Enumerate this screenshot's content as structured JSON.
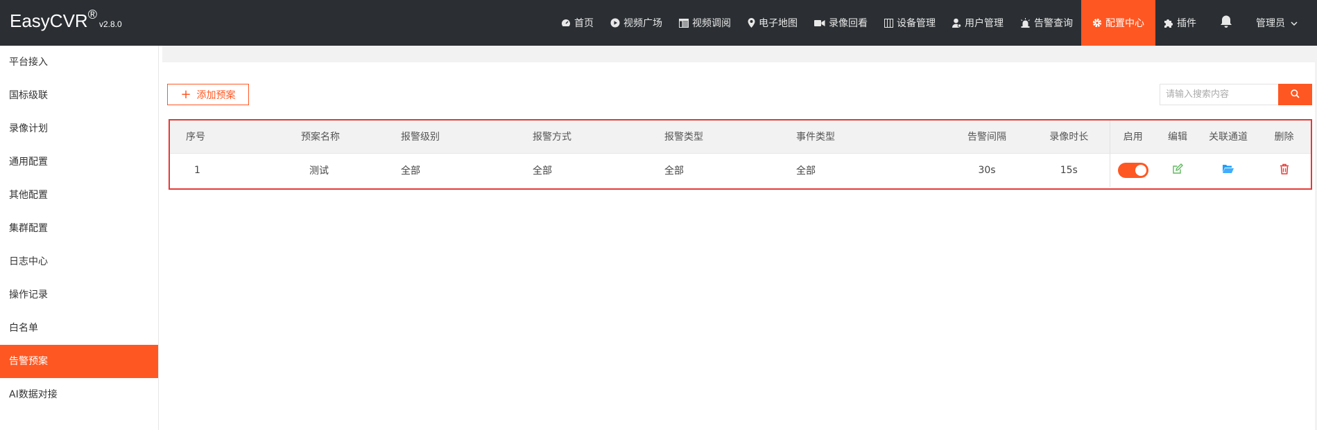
{
  "app": {
    "brand": "EasyCVR",
    "registered_mark": "®",
    "version": "v2.8.0"
  },
  "nav": {
    "items": [
      {
        "label": "首页",
        "icon": "dashboard-icon"
      },
      {
        "label": "视频广场",
        "icon": "play-circle-icon"
      },
      {
        "label": "视频调阅",
        "icon": "grid-view-icon"
      },
      {
        "label": "电子地图",
        "icon": "map-pin-icon"
      },
      {
        "label": "录像回看",
        "icon": "video-camera-icon"
      },
      {
        "label": "设备管理",
        "icon": "device-icon"
      },
      {
        "label": "用户管理",
        "icon": "user-icon"
      },
      {
        "label": "告警查询",
        "icon": "alarm-icon"
      },
      {
        "label": "配置中心",
        "icon": "gear-icon"
      },
      {
        "label": "插件",
        "icon": "puzzle-icon"
      }
    ],
    "active_index": 8,
    "user_label": "管理员"
  },
  "sidebar": {
    "items": [
      {
        "label": "平台接入"
      },
      {
        "label": "国标级联"
      },
      {
        "label": "录像计划"
      },
      {
        "label": "通用配置"
      },
      {
        "label": "其他配置"
      },
      {
        "label": "集群配置"
      },
      {
        "label": "日志中心"
      },
      {
        "label": "操作记录"
      },
      {
        "label": "白名单"
      },
      {
        "label": "告警预案"
      },
      {
        "label": "AI数据对接"
      }
    ],
    "active_index": 9
  },
  "toolbar": {
    "add_label": "添加预案",
    "search_placeholder": "请输入搜索内容"
  },
  "table": {
    "headers": [
      "序号",
      "预案名称",
      "报警级别",
      "报警方式",
      "报警类型",
      "事件类型",
      "告警间隔",
      "录像时长",
      "启用",
      "编辑",
      "关联通道",
      "删除"
    ],
    "rows": [
      {
        "index": "1",
        "name": "测试",
        "level": "全部",
        "method": "全部",
        "alarm_type": "全部",
        "event_type": "全部",
        "interval": "30s",
        "duration": "15s",
        "enabled": true
      }
    ]
  },
  "colors": {
    "accent": "#ff5722",
    "topbar": "#2b2f33",
    "edit": "#5fb85f",
    "channel": "#1e9fff",
    "delete": "#e53935",
    "highlight_border": "#e53935"
  }
}
